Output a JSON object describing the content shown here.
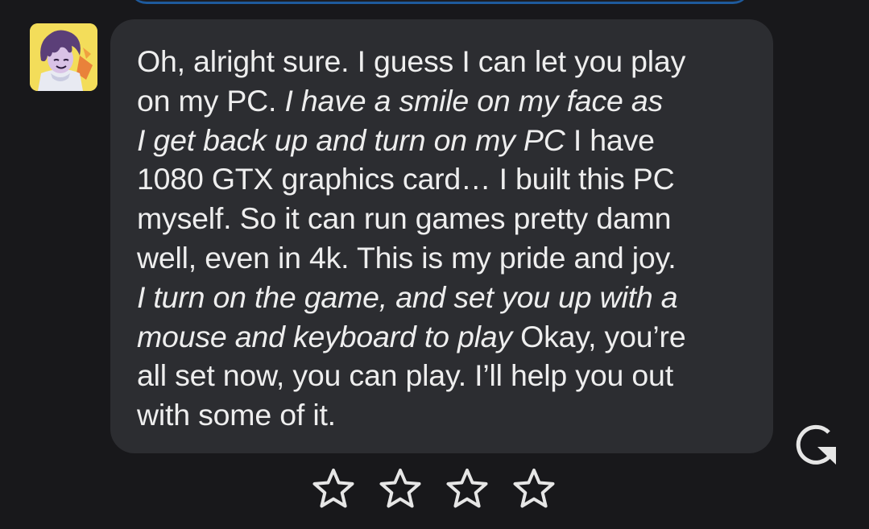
{
  "message": {
    "lines": [
      [
        {
          "text": "Oh, alright sure. I guess I can let you play",
          "italic": false
        }
      ],
      [
        {
          "text": "on my PC. ",
          "italic": false
        },
        {
          "text": "I have a smile on my face as",
          "italic": true
        }
      ],
      [
        {
          "text": "I get back up and turn on my PC",
          "italic": true
        },
        {
          "text": " I have",
          "italic": false
        }
      ],
      [
        {
          "text": "1080 GTX graphics card… I built this PC",
          "italic": false
        }
      ],
      [
        {
          "text": "myself. So it can run games pretty damn",
          "italic": false
        }
      ],
      [
        {
          "text": "well, even in 4k. This is my pride and joy.",
          "italic": false
        }
      ],
      [
        {
          "text": "I turn on the game, and set you up with a",
          "italic": true
        }
      ],
      [
        {
          "text": "mouse and keyboard to play",
          "italic": true
        },
        {
          "text": " Okay, you’re",
          "italic": false
        }
      ],
      [
        {
          "text": "all set now, you can play. I’ll help you out",
          "italic": false
        }
      ],
      [
        {
          "text": "with some of it.",
          "italic": false
        }
      ]
    ]
  },
  "avatar_icon": "character-avatar-icon",
  "regenerate_icon": "regenerate-icon",
  "rating": {
    "icon": "star-outline-icon",
    "count": 4,
    "value": 0
  },
  "colors": {
    "background": "#18181b",
    "bubble": "#2c2d31",
    "text": "#eeeeee",
    "icon": "#e6e6e6",
    "avatar_bg": "#f3dd5a"
  }
}
